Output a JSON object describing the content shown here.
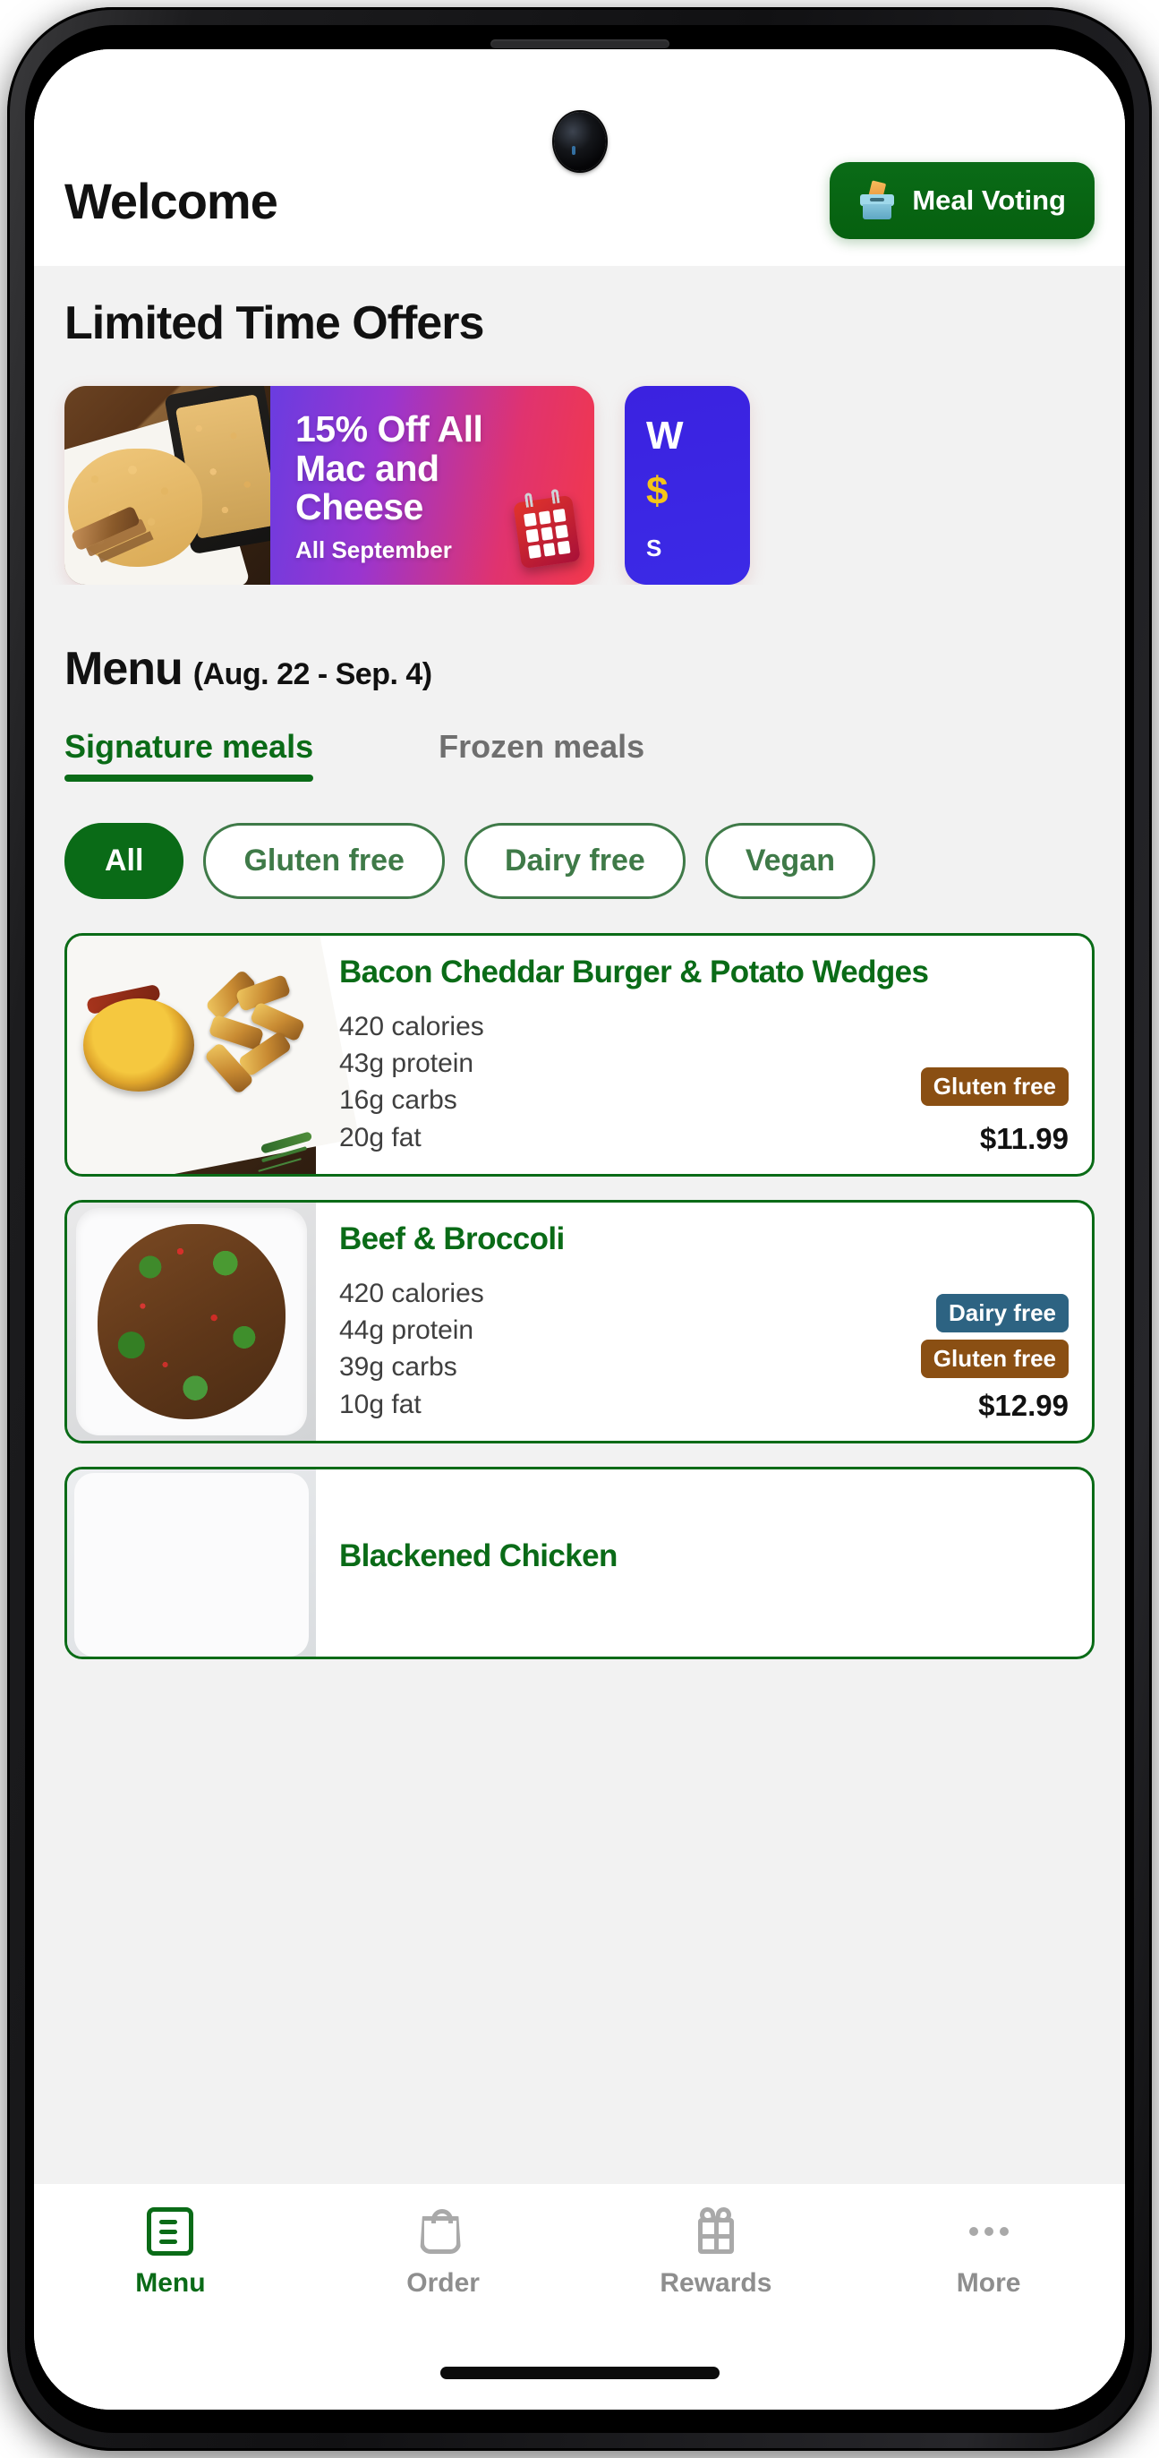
{
  "header": {
    "welcome_title": "Welcome",
    "meal_voting_label": "Meal Voting",
    "meal_voting_icon": "ballot-box-icon"
  },
  "offers": {
    "section_title": "Limited Time Offers",
    "banners": [
      {
        "headline": "15% Off All Mac and Cheese",
        "subtext": "All September",
        "icon": "calendar-icon",
        "photo_alt": "mac-and-cheese-with-grilled-chicken",
        "gradient_from": "#6a3ce0",
        "gradient_to": "#f2384b"
      },
      {
        "headline_peek": "W",
        "accent_peek": "$",
        "sub_peek": "S",
        "background": "#3b22e0"
      }
    ]
  },
  "menu": {
    "heading_word": "Menu",
    "heading_range": "(Aug. 22 - Sep. 4)",
    "tabs": [
      {
        "label": "Signature meals",
        "active": true
      },
      {
        "label": "Frozen meals",
        "active": false
      }
    ],
    "filters": [
      {
        "label": "All",
        "active": true
      },
      {
        "label": "Gluten free",
        "active": false
      },
      {
        "label": "Dairy free",
        "active": false
      },
      {
        "label": "Vegan",
        "active": false
      }
    ],
    "items": [
      {
        "title": "Bacon Cheddar Burger & Potato Wedges",
        "calories": "420 calories",
        "protein": "43g protein",
        "carbs": "16g carbs",
        "fat": "20g fat",
        "price": "$11.99",
        "badges": [
          {
            "label": "Gluten free",
            "color": "#8a4f13"
          }
        ]
      },
      {
        "title": "Beef & Broccoli",
        "calories": "420 calories",
        "protein": "44g protein",
        "carbs": "39g carbs",
        "fat": "10g fat",
        "price": "$12.99",
        "badges": [
          {
            "label": "Dairy free",
            "color": "#2d6382"
          },
          {
            "label": "Gluten free",
            "color": "#8a4f13"
          }
        ]
      },
      {
        "title": "Blackened Chicken"
      }
    ]
  },
  "bottom_nav": [
    {
      "label": "Menu",
      "icon": "list-icon",
      "active": true
    },
    {
      "label": "Order",
      "icon": "shopping-bag-icon",
      "active": false
    },
    {
      "label": "Rewards",
      "icon": "gift-icon",
      "active": false
    },
    {
      "label": "More",
      "icon": "ellipsis-icon",
      "active": false
    }
  ],
  "theme": {
    "brand_green": "#0a6b17",
    "inactive_gray": "#8e8e8e",
    "app_background": "#f2f2f2"
  }
}
